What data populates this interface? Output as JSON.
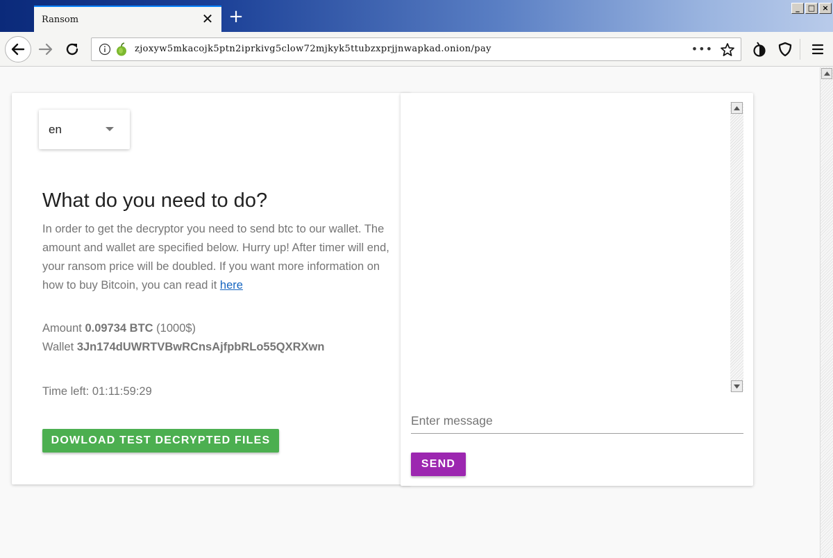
{
  "browser": {
    "tab_title": "Ransom",
    "tab_close_glyph": "✕",
    "new_tab_glyph": "+",
    "url": "zjoxyw5mkacojk5ptn2iprkivg5clow72mjkyk5ttubzxprjjnwapkad.onion/pay",
    "more_glyph": "•••",
    "window_buttons": [
      "_",
      "□",
      "×"
    ],
    "colors": {
      "tab_accent": "#0a84ff",
      "titlebar_start": "#0b2a7a"
    }
  },
  "language_select": {
    "value": "en"
  },
  "instructions": {
    "heading": "What do you need to do?",
    "text": "In order to get the decryptor you need to send btc to our wallet. The amount and wallet are specified below. Hurry up! After timer will end, your ransom price will be doubled. If you want more information on how to buy Bitcoin, you can read it ",
    "link_text": "here"
  },
  "payment": {
    "amount_label": "Amount ",
    "amount_value": "0.09734 BTC",
    "amount_usd": " (1000$)",
    "wallet_label": "Wallet ",
    "wallet_value": "3Jn174dUWRTVBwRCnsAjfpbRLo55QXRXwn"
  },
  "timer": {
    "label": "Time left: ",
    "value": "01:11:59:29"
  },
  "download_button": {
    "label": "DOWLOAD TEST DECRYPTED FILES",
    "color": "#4caf50"
  },
  "chat": {
    "input_placeholder": "Enter message",
    "send_label": "SEND",
    "send_color": "#9c27b0"
  },
  "icons": [
    "back-arrow-icon",
    "forward-arrow-icon",
    "reload-icon",
    "info-icon",
    "onion-icon",
    "star-icon",
    "tor-onion-icon",
    "shield-icon",
    "hamburger-menu-icon"
  ]
}
